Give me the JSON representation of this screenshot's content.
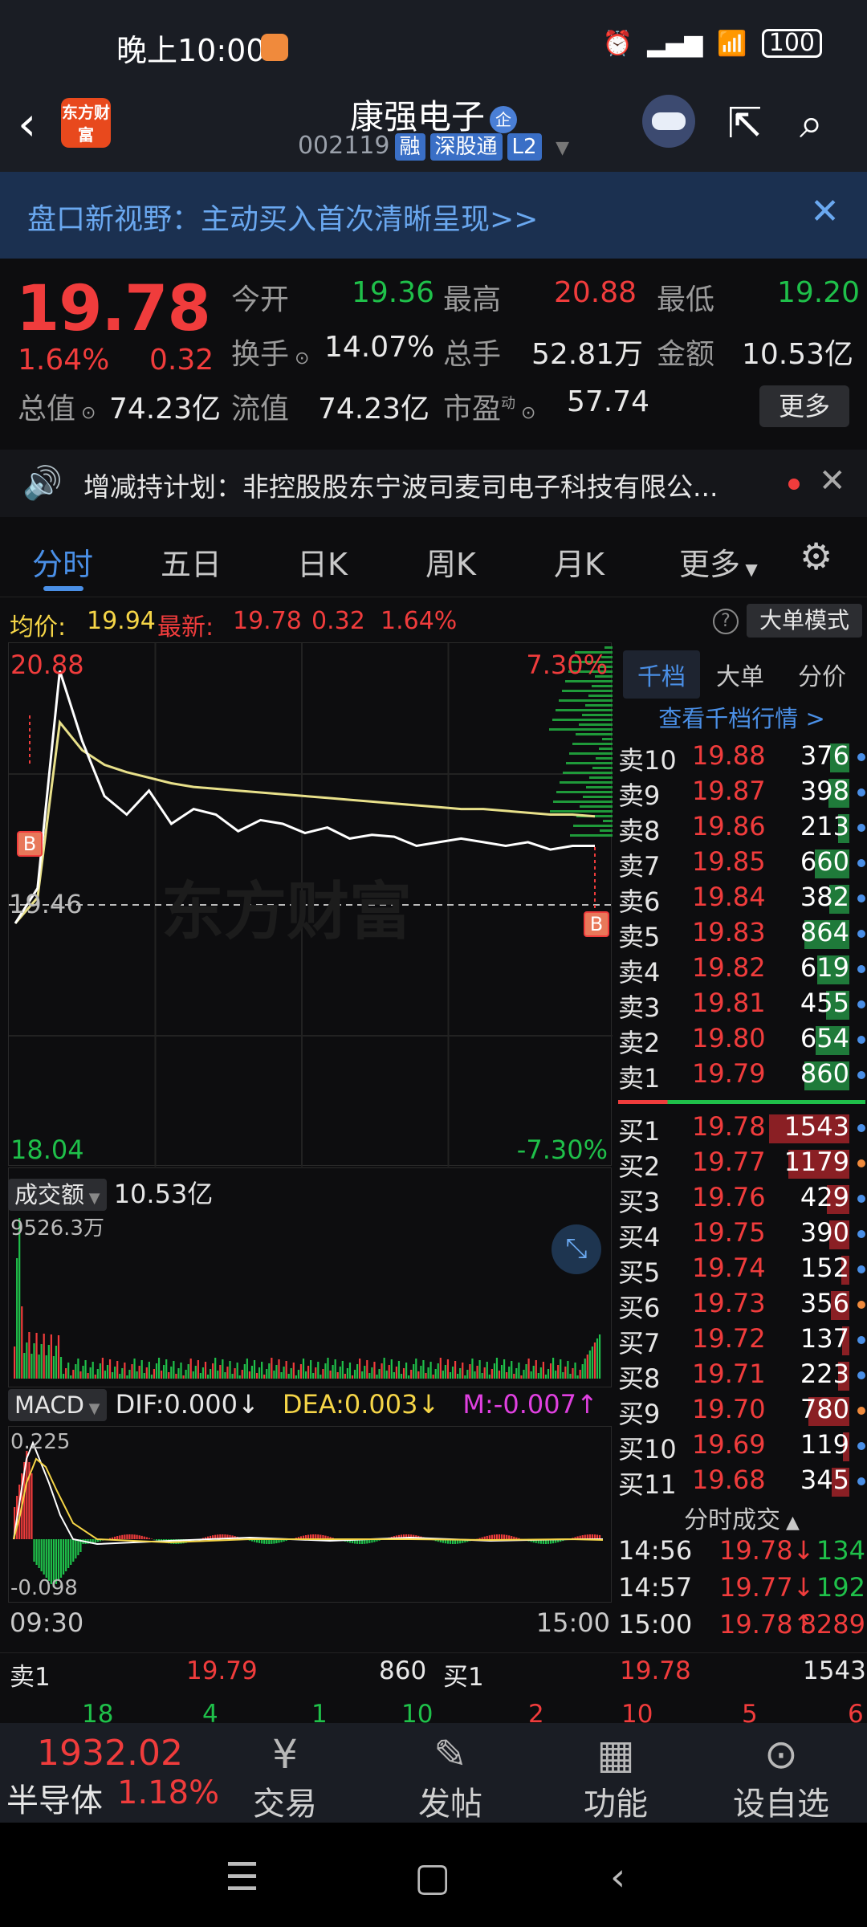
{
  "status_bar": {
    "time": "晚上10:00",
    "battery": "100"
  },
  "header": {
    "title": "康强电子",
    "title_badge": "企",
    "code": "002119",
    "tags": [
      "融",
      "深股通",
      "L2"
    ],
    "logo_text": "东方财富"
  },
  "banner": {
    "text": "盘口新视野：主动买入首次清晰呈现>>"
  },
  "quote": {
    "price": "19.78",
    "pct": "1.64%",
    "change": "0.32",
    "fields": [
      {
        "label": "今开",
        "value": "19.36",
        "color": "green"
      },
      {
        "label": "最高",
        "value": "20.88",
        "color": "red"
      },
      {
        "label": "最低",
        "value": "19.20",
        "color": "green"
      },
      {
        "label": "换手",
        "value": "14.07%",
        "color": "white"
      },
      {
        "label": "总手",
        "value": "52.81万",
        "color": "white"
      },
      {
        "label": "金额",
        "value": "10.53亿",
        "color": "white"
      },
      {
        "label": "总值",
        "value": "74.23亿",
        "color": "white"
      },
      {
        "label": "流值",
        "value": "74.23亿",
        "color": "white"
      },
      {
        "label": "市盈",
        "value": "57.74",
        "color": "white"
      }
    ],
    "pe_superscript": "动",
    "more_label": "更多"
  },
  "notice": {
    "text": "增减持计划：非控股股东宁波司麦司电子科技有限公..."
  },
  "tabs": [
    "分时",
    "五日",
    "日K",
    "周K",
    "月K",
    "更多"
  ],
  "avg_row": {
    "avg_label": "均价:",
    "avg_value": "19.94",
    "latest_label": "最新:",
    "latest_value": "19.78",
    "change": "0.32",
    "pct": "1.64%",
    "big_order_label": "大单模式"
  },
  "chart": {
    "high_label": "20.88",
    "low_label": "18.04",
    "ref_label": "19.46",
    "high_pct": "7.30%",
    "low_pct": "-7.30%",
    "watermark": "东方财富",
    "b_marker": "B"
  },
  "chart_data": {
    "type": "line",
    "title": "",
    "ylim": [
      18.04,
      20.88
    ],
    "reference": 19.46,
    "x_start": "09:30",
    "x_end": "15:00",
    "series": [
      {
        "name": "",
        "color": "#ffffff",
        "values": [
          19.36,
          19.55,
          20.73,
          20.35,
          20.05,
          19.95,
          20.08,
          19.9,
          19.98,
          19.95,
          19.86,
          19.92,
          19.9,
          19.85,
          19.88,
          19.82,
          19.84,
          19.83,
          19.78,
          19.8,
          19.82,
          19.8,
          19.78,
          19.8,
          19.76,
          19.78,
          19.78
        ]
      },
      {
        "name": "",
        "color": "#e8e08a",
        "values": [
          19.36,
          19.5,
          20.45,
          20.3,
          20.22,
          20.18,
          20.15,
          20.12,
          20.1,
          20.09,
          20.08,
          20.07,
          20.06,
          20.05,
          20.04,
          20.03,
          20.02,
          20.01,
          20.0,
          19.99,
          19.98,
          19.98,
          19.97,
          19.96,
          19.95,
          19.95,
          19.94
        ]
      }
    ]
  },
  "volume": {
    "label": "成交额",
    "total": "10.53亿",
    "max_label": "9526.3万"
  },
  "macd": {
    "label": "MACD",
    "dif": "DIF:0.000↓",
    "dea": "DEA:0.003↓",
    "m": "M:-0.007↑",
    "top_label": "0.225",
    "bottom_label": "-0.098"
  },
  "time_axis": {
    "start": "09:30",
    "end": "15:00"
  },
  "order_book": {
    "tabs": [
      "千档",
      "大单",
      "分价"
    ],
    "link": "查看千档行情 >",
    "asks": [
      {
        "name": "卖10",
        "price": "19.88",
        "vol": "376"
      },
      {
        "name": "卖9",
        "price": "19.87",
        "vol": "398"
      },
      {
        "name": "卖8",
        "price": "19.86",
        "vol": "213"
      },
      {
        "name": "卖7",
        "price": "19.85",
        "vol": "660"
      },
      {
        "name": "卖6",
        "price": "19.84",
        "vol": "382"
      },
      {
        "name": "卖5",
        "price": "19.83",
        "vol": "864"
      },
      {
        "name": "卖4",
        "price": "19.82",
        "vol": "619"
      },
      {
        "name": "卖3",
        "price": "19.81",
        "vol": "455"
      },
      {
        "name": "卖2",
        "price": "19.80",
        "vol": "654"
      },
      {
        "name": "卖1",
        "price": "19.79",
        "vol": "860"
      }
    ],
    "bids": [
      {
        "name": "买1",
        "price": "19.78",
        "vol": "1543"
      },
      {
        "name": "买2",
        "price": "19.77",
        "vol": "1179"
      },
      {
        "name": "买3",
        "price": "19.76",
        "vol": "429"
      },
      {
        "name": "买4",
        "price": "19.75",
        "vol": "390"
      },
      {
        "name": "买5",
        "price": "19.74",
        "vol": "152"
      },
      {
        "name": "买6",
        "price": "19.73",
        "vol": "356"
      },
      {
        "name": "买7",
        "price": "19.72",
        "vol": "137"
      },
      {
        "name": "买8",
        "price": "19.71",
        "vol": "223"
      },
      {
        "name": "买9",
        "price": "19.70",
        "vol": "780"
      },
      {
        "name": "买10",
        "price": "19.69",
        "vol": "119"
      },
      {
        "name": "买11",
        "price": "19.68",
        "vol": "345"
      }
    ]
  },
  "trades": {
    "header": "分时成交",
    "rows": [
      {
        "time": "14:56",
        "price": "19.78↓",
        "vol": "134",
        "dir": "down"
      },
      {
        "time": "14:57",
        "price": "19.77↓",
        "vol": "192",
        "dir": "down"
      },
      {
        "time": "15:00",
        "price": "19.78↑",
        "vol": "8289",
        "dir": "up"
      }
    ]
  },
  "summary": {
    "sell_label": "卖1",
    "sell_price": "19.79",
    "sell_vol": "860",
    "buy_label": "买1",
    "buy_price": "19.78",
    "buy_vol": "1543",
    "left_nums": [
      "18",
      "4",
      "1",
      "10"
    ],
    "right_nums": [
      "2",
      "10",
      "5",
      "6"
    ]
  },
  "bottom_nav": {
    "index_value": "1932.02",
    "index_name": "半导体",
    "index_pct": "1.18%",
    "buttons": [
      "交易",
      "发帖",
      "功能",
      "设自选"
    ]
  }
}
